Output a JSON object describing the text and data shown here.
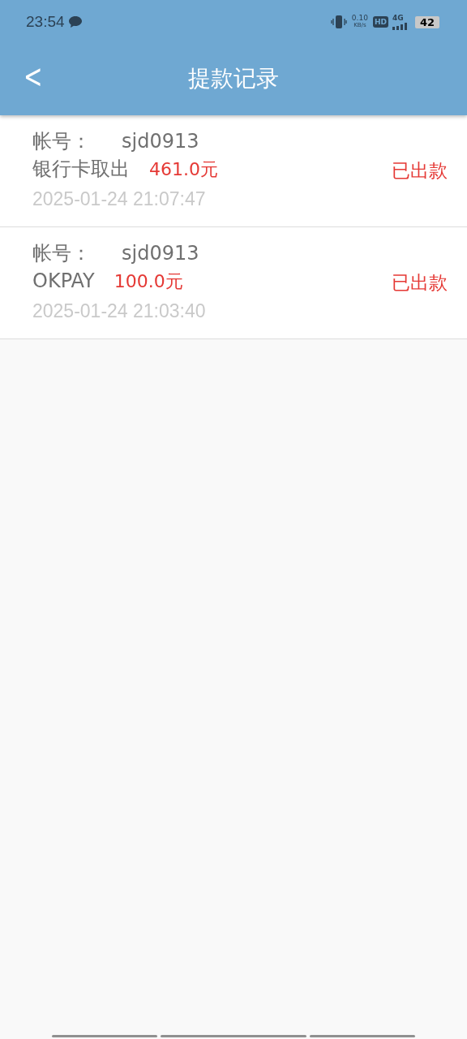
{
  "status_bar": {
    "time": "23:54",
    "net_speed": "0.10",
    "net_unit": "KB/s",
    "hd": "HD",
    "network": "4G",
    "battery": "42"
  },
  "header": {
    "back": "<",
    "title": "提款记录"
  },
  "records": [
    {
      "account_label": "帐号：",
      "account": "sjd0913",
      "method": "银行卡取出",
      "amount": "461.0元",
      "time": "2025-01-24 21:07:47",
      "status": "已出款"
    },
    {
      "account_label": "帐号：",
      "account": "sjd0913",
      "method": "OKPAY",
      "amount": "100.0元",
      "time": "2025-01-24 21:03:40",
      "status": "已出款"
    }
  ]
}
